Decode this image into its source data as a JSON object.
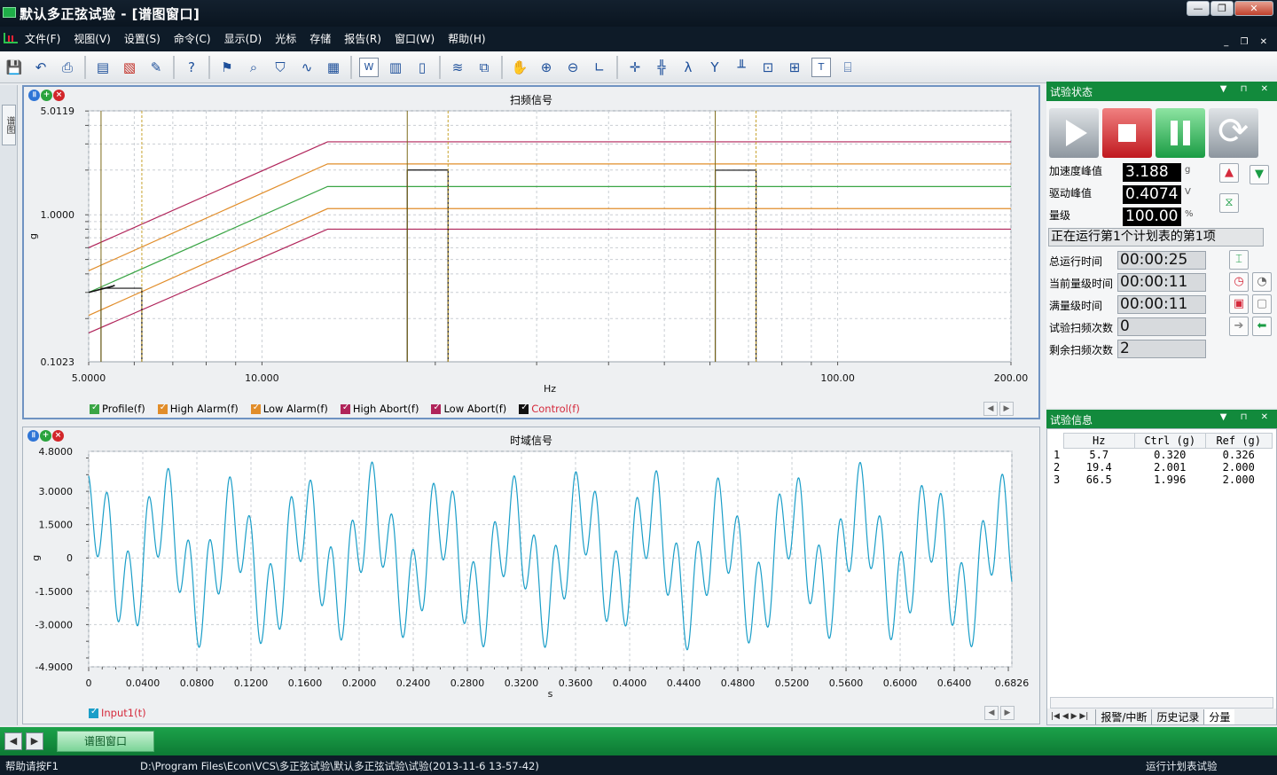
{
  "window": {
    "title": "默认多正弦试验 - [谱图窗口]",
    "buttons": [
      "—",
      "❐",
      "✕"
    ]
  },
  "menu": {
    "items": [
      "文件(F)",
      "视图(V)",
      "设置(S)",
      "命令(C)",
      "显示(D)",
      "光标",
      "存储",
      "报告(R)",
      "窗口(W)",
      "帮助(H)"
    ],
    "mdi": "_ ❐ ✕"
  },
  "toolbar": {
    "icons": [
      "save-icon",
      "undo-icon",
      "print-icon",
      "sep",
      "export-word-icon",
      "pdf-icon",
      "settings-wand-icon",
      "sep",
      "help-icon",
      "sep",
      "flag-icon",
      "zoom-window-icon",
      "shield-icon",
      "waveform-icon",
      "report-icon",
      "sep",
      "word-icon",
      "layout-icon",
      "page-icon",
      "sep",
      "overlay-icon",
      "plot-icon",
      "sep",
      "hand-icon",
      "zoom-in-icon",
      "zoom-out-icon",
      "axis-icon",
      "sep",
      "cursor-cross-icon",
      "cursor-dual-icon",
      "cursor-lambda-icon",
      "cursor-y-icon",
      "peak-icon",
      "zoom-box-icon",
      "zoom-box2-icon",
      "text-tool-icon",
      "marker-icon"
    ]
  },
  "leftstrip": {
    "tab": "谱图"
  },
  "spectrum": {
    "title": "扫频信号",
    "ylabel": "g",
    "xlabel": "Hz",
    "yticks": [
      "5.0119",
      "1.0000",
      "0.1023"
    ],
    "xticks": [
      "5.0000",
      "10.000",
      "100.00",
      "200.00"
    ],
    "legend": [
      {
        "label": "Profile(f)",
        "color": "#3aa545"
      },
      {
        "label": "High Alarm(f)",
        "color": "#e18d2a"
      },
      {
        "label": "Low Alarm(f)",
        "color": "#e18d2a"
      },
      {
        "label": "High Abort(f)",
        "color": "#b0245a"
      },
      {
        "label": "Low Abort(f)",
        "color": "#b0245a"
      },
      {
        "label": "Control(f)",
        "color": "#111111",
        "labelColor": "#d52a3c"
      }
    ]
  },
  "timedomain": {
    "title": "时域信号",
    "ylabel": "g",
    "xlabel": "s",
    "yticks": [
      "4.8000",
      "3.0000",
      "1.5000",
      "0",
      "-1.5000",
      "-3.0000",
      "-4.9000"
    ],
    "xticks": [
      "0",
      "0.0400",
      "0.0800",
      "0.1200",
      "0.1600",
      "0.2000",
      "0.2400",
      "0.2800",
      "0.3200",
      "0.3600",
      "0.4000",
      "0.4400",
      "0.4800",
      "0.5200",
      "0.5600",
      "0.6000",
      "0.6400",
      "0.6826"
    ],
    "legend": [
      {
        "label": "Input1(t)",
        "color": "#1a9ec8",
        "labelColor": "#d52a3c"
      }
    ]
  },
  "chart_data": [
    {
      "type": "line",
      "title": "扫频信号",
      "xlabel": "Hz",
      "ylabel": "g",
      "xscale": "log",
      "yscale": "log",
      "xlim": [
        5,
        200
      ],
      "ylim": [
        0.1023,
        5.0119
      ],
      "series": [
        {
          "name": "High Abort(f)",
          "x": [
            5,
            13,
            200
          ],
          "y": [
            0.6,
            3.1,
            3.1
          ]
        },
        {
          "name": "High Alarm(f)",
          "x": [
            5,
            13,
            200
          ],
          "y": [
            0.42,
            2.2,
            2.2
          ]
        },
        {
          "name": "Profile(f)",
          "x": [
            5,
            13,
            200
          ],
          "y": [
            0.3,
            1.55,
            1.55
          ]
        },
        {
          "name": "Low Alarm(f)",
          "x": [
            5,
            13,
            200
          ],
          "y": [
            0.21,
            1.1,
            1.1
          ]
        },
        {
          "name": "Low Abort(f)",
          "x": [
            5,
            13,
            200
          ],
          "y": [
            0.16,
            0.8,
            0.8
          ]
        },
        {
          "name": "Control(f)",
          "x": [
            5,
            5.7,
            19.4,
            66.5
          ],
          "y": [
            0.32,
            0.32,
            2.001,
            1.996
          ]
        }
      ]
    },
    {
      "type": "line",
      "title": "时域信号",
      "xlabel": "s",
      "ylabel": "g",
      "xlim": [
        0,
        0.6826
      ],
      "ylim": [
        -4.9,
        4.8
      ],
      "series": [
        {
          "name": "Input1(t)",
          "components": [
            {
              "freq": 5.7,
              "amp": 0.32
            },
            {
              "freq": 19.4,
              "amp": 2.0
            },
            {
              "freq": 66.5,
              "amp": 2.0
            }
          ]
        }
      ]
    }
  ],
  "status": {
    "header": "试验状态",
    "accel_label": "加速度峰值",
    "accel_value": "3.188",
    "accel_unit": "g",
    "drive_label": "驱动峰值",
    "drive_value": "0.4074",
    "drive_unit": "V",
    "level_label": "量级",
    "level_value": "100.00",
    "level_unit": "%",
    "message": "正在运行第1个计划表的第1项",
    "total_time_label": "总运行时间",
    "total_time": "00:00:25",
    "cur_level_time_label": "当前量级时间",
    "cur_level_time": "00:00:11",
    "full_level_time_label": "满量级时间",
    "full_level_time": "00:00:11",
    "sweeps_label": "试验扫频次数",
    "sweeps": "0",
    "remaining_label": "剩余扫频次数",
    "remaining": "2"
  },
  "info": {
    "header": "试验信息",
    "columns": [
      "Hz",
      "Ctrl (g)",
      "Ref (g)"
    ],
    "rows": [
      [
        "1",
        "5.7",
        "0.320",
        "0.326"
      ],
      [
        "2",
        "19.4",
        "2.001",
        "2.000"
      ],
      [
        "3",
        "66.5",
        "1.996",
        "2.000"
      ]
    ],
    "tabs": [
      "报警/中断",
      "历史记录",
      "分量"
    ]
  },
  "docbar": {
    "tab": "谱图窗口"
  },
  "statusbar": {
    "help": "帮助请按F1",
    "path": "D:\\Program Files\\Econ\\VCS\\多正弦试验\\默认多正弦试验\\试验(2013-11-6 13-57-42)",
    "mode": "运行计划表试验"
  }
}
